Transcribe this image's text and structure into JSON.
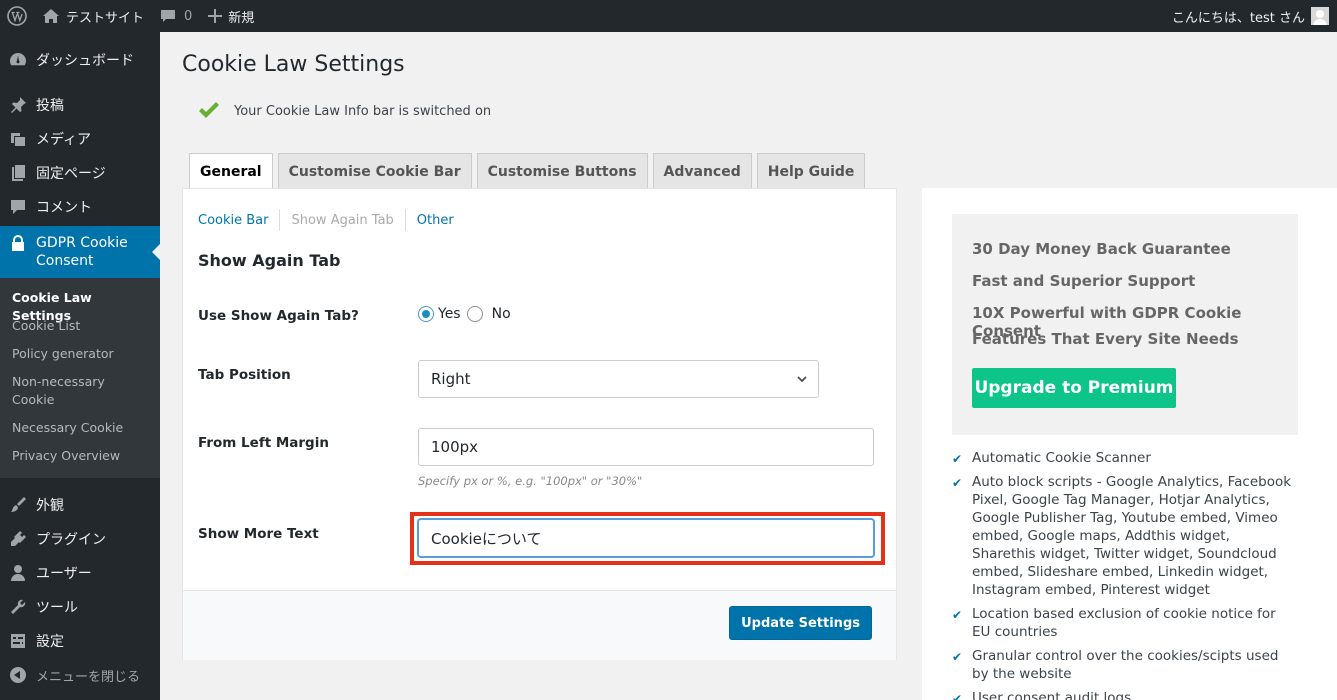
{
  "adminbar": {
    "site_name": "テストサイト",
    "comments_count": "0",
    "new_label": "新規",
    "greeting": "こんにちは、test さん"
  },
  "sidebar": {
    "items": [
      {
        "label": "ダッシュボード",
        "icon": "dashboard-icon"
      },
      {
        "label": "投稿",
        "icon": "pin-icon"
      },
      {
        "label": "メディア",
        "icon": "media-icon"
      },
      {
        "label": "固定ページ",
        "icon": "page-icon"
      },
      {
        "label": "コメント",
        "icon": "comment-icon"
      },
      {
        "label": "GDPR Cookie Consent",
        "icon": "lock-icon"
      },
      {
        "label": "外観",
        "icon": "brush-icon"
      },
      {
        "label": "プラグイン",
        "icon": "plugin-icon"
      },
      {
        "label": "ユーザー",
        "icon": "user-icon"
      },
      {
        "label": "ツール",
        "icon": "wrench-icon"
      },
      {
        "label": "設定",
        "icon": "settings-icon"
      }
    ],
    "submenu": [
      "Cookie Law Settings",
      "Cookie List",
      "Policy generator",
      "Non-necessary Cookie",
      "Necessary Cookie",
      "Privacy Overview"
    ],
    "collapse_label": "メニューを閉じる"
  },
  "main": {
    "title": "Cookie Law Settings",
    "notice": "Your Cookie Law Info bar is switched on",
    "tabs": [
      "General",
      "Customise Cookie Bar",
      "Customise Buttons",
      "Advanced",
      "Help Guide"
    ],
    "subtabs": [
      "Cookie Bar",
      "Show Again Tab",
      "Other"
    ],
    "section_title": "Show Again Tab",
    "use_tab_label": "Use Show Again Tab?",
    "radio_yes": "Yes",
    "radio_no": "No",
    "tab_position_label": "Tab Position",
    "tab_position_value": "Right",
    "left_margin_label": "From Left Margin",
    "left_margin_value": "100px",
    "left_margin_hint": "Specify px or %, e.g. \"100px\" or \"30%\"",
    "show_more_label": "Show More Text",
    "show_more_value": "Cookieについて",
    "update_button": "Update Settings"
  },
  "promo": {
    "lines": [
      "30 Day Money Back Guarantee",
      "Fast and Superior Support",
      "10X Powerful with GDPR Cookie Consent",
      "Features That Every Site Needs"
    ],
    "upgrade_button": "Upgrade to Premium",
    "features": [
      "Automatic Cookie Scanner",
      "Auto block scripts - Google Analytics, Facebook Pixel, Google Tag Manager, Hotjar Analytics, Google Publisher Tag, Youtube embed, Vimeo embed, Google maps, Addthis widget, Sharethis widget, Twitter widget, Soundcloud embed, Slideshare embed, Linkedin widget, Instagram embed, Pinterest widget",
      "Location based exclusion of cookie notice for EU countries",
      "Granular control over the cookies/scipts used by the website",
      "User consent audit logs"
    ]
  },
  "colors": {
    "adminbar_bg": "#23282d",
    "active_menu": "#0073aa",
    "upgrade_green": "#0ec589",
    "highlight_red": "#e6301a"
  }
}
